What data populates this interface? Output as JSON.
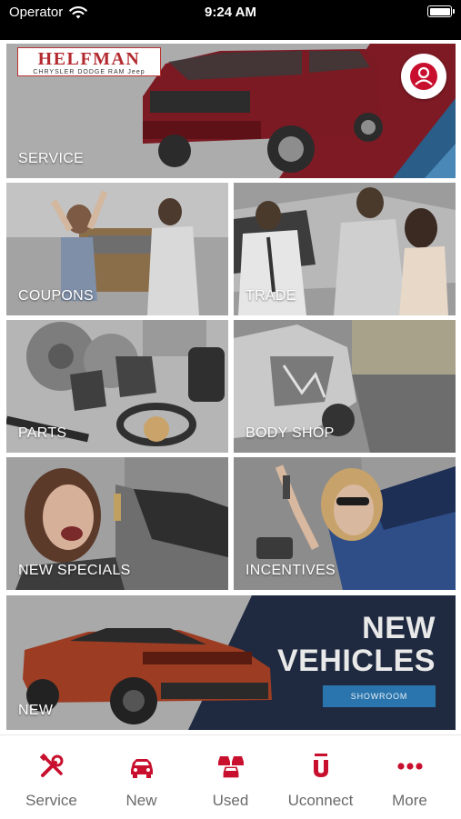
{
  "status_bar": {
    "carrier": "Operator",
    "time": "9:24 AM"
  },
  "accent_color": "#c8102e",
  "header_tile": {
    "brand": "HELFMAN",
    "brand_sub": "CHRYSLER  DODGE  RAM  Jeep",
    "label": "SERVICE",
    "profile_icon": "user-circle-icon"
  },
  "tiles": [
    {
      "key": "coupons",
      "label": "COUPONS"
    },
    {
      "key": "trade",
      "label": "TRADE"
    },
    {
      "key": "parts",
      "label": "PARTS"
    },
    {
      "key": "body_shop",
      "label": "BODY SHOP"
    },
    {
      "key": "new_specials",
      "label": "NEW SPECIALS"
    },
    {
      "key": "incentives",
      "label": "INCENTIVES"
    }
  ],
  "new_tile": {
    "label": "NEW",
    "heading_line1": "NEW",
    "heading_line2": "VEHICLES",
    "button": "SHOWROOM"
  },
  "tab_bar": [
    {
      "label": "Service",
      "icon": "wrench-screwdriver-icon"
    },
    {
      "label": "New",
      "icon": "car-icon"
    },
    {
      "label": "Used",
      "icon": "cars-stack-icon"
    },
    {
      "label": "Uconnect",
      "icon": "uconnect-icon"
    },
    {
      "label": "More",
      "icon": "more-dots-icon"
    }
  ]
}
